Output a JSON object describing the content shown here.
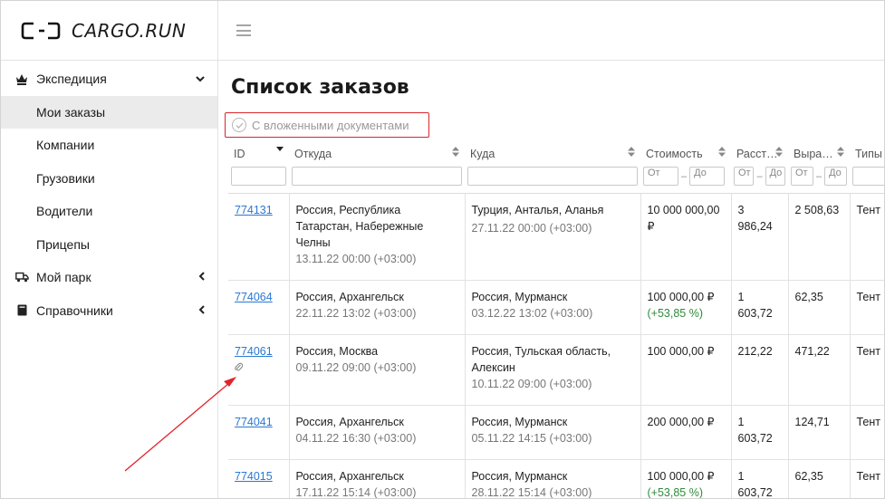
{
  "app": {
    "logo_text": "CARGO.RUN"
  },
  "sidebar": {
    "expedition": {
      "label": "Экспедиция"
    },
    "sub_items": [
      {
        "label": "Мои заказы",
        "active": true
      },
      {
        "label": "Компании",
        "active": false
      },
      {
        "label": "Грузовики",
        "active": false
      },
      {
        "label": "Водители",
        "active": false
      },
      {
        "label": "Прицепы",
        "active": false
      }
    ],
    "my_park": {
      "label": "Мой парк"
    },
    "directories": {
      "label": "Справочники"
    }
  },
  "main": {
    "title": "Список заказов",
    "filter_chip": "С вложенными документами"
  },
  "table": {
    "headers": {
      "id": "ID",
      "from": "Откуда",
      "to": "Куда",
      "cost": "Стоимость",
      "distance": "Расст…",
      "revenue": "Выра…",
      "types": "Типы"
    },
    "range_from": "От",
    "range_to": "До",
    "range_dash": "–",
    "rows": [
      {
        "id": "774131",
        "from": "Россия, Республика Татарстан, Набережные Челны",
        "from_date": "13.11.22 00:00 (+03:00)",
        "to": "Турция, Анталья, Аланья",
        "to_date": "27.11.22 00:00 (+03:00)",
        "cost": "10 000 000,00 ₽",
        "cost_pct": "",
        "distance": "3 986,24",
        "revenue": "2 508,63",
        "type": "Тент",
        "has_docs": false
      },
      {
        "id": "774064",
        "from": "Россия, Архангельск",
        "from_date": "22.11.22 13:02 (+03:00)",
        "to": "Россия, Мурманск",
        "to_date": "03.12.22 13:02 (+03:00)",
        "cost": "100 000,00 ₽",
        "cost_pct": "(+53,85 %)",
        "distance": "1 603,72",
        "revenue": "62,35",
        "type": "Тент",
        "has_docs": false
      },
      {
        "id": "774061",
        "from": "Россия, Москва",
        "from_date": "09.11.22 09:00 (+03:00)",
        "to": "Россия, Тульская область, Алексин",
        "to_date": "10.11.22 09:00 (+03:00)",
        "cost": "100 000,00 ₽",
        "cost_pct": "",
        "distance": "212,22",
        "revenue": "471,22",
        "type": "Тент",
        "has_docs": true
      },
      {
        "id": "774041",
        "from": "Россия, Архангельск",
        "from_date": "04.11.22 16:30 (+03:00)",
        "to": "Россия, Мурманск",
        "to_date": "05.11.22 14:15 (+03:00)",
        "cost": "200 000,00 ₽",
        "cost_pct": "",
        "distance": "1 603,72",
        "revenue": "124,71",
        "type": "Тент",
        "has_docs": false
      },
      {
        "id": "774015",
        "from": "Россия, Архангельск",
        "from_date": "17.11.22 15:14 (+03:00)",
        "to": "Россия, Мурманск",
        "to_date": "28.11.22 15:14 (+03:00)",
        "cost": "100 000,00 ₽",
        "cost_pct": "(+53,85 %)",
        "distance": "1 603,72",
        "revenue": "62,35",
        "type": "Тент",
        "has_docs": false
      }
    ]
  },
  "colors": {
    "link": "#2a78d4",
    "positive": "#2e8b3a",
    "annotation": "#e0242a",
    "active_nav": "#ebebeb"
  },
  "icons": [
    "logo-mark-icon",
    "crown-icon",
    "chevron-down-icon",
    "truck-icon",
    "chevron-left-icon",
    "book-icon",
    "menu-icon",
    "check-circle-icon",
    "sort-icon",
    "paperclip-icon"
  ]
}
